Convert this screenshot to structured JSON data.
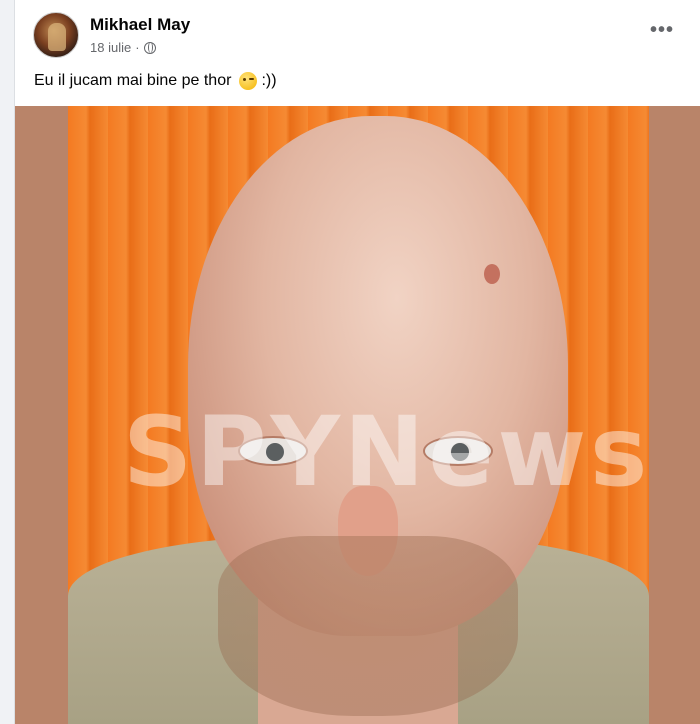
{
  "post": {
    "author": "Mikhael May",
    "date": "18 iulie",
    "separator": "·",
    "privacy_icon": "globe-icon",
    "more_label": "•••",
    "text": "Eu il jucam mai bine pe thor",
    "emoji_icon": "wink-emoji-icon",
    "text_suffix": ":))"
  },
  "photo": {
    "watermark": "SPYNews",
    "background_color": "#f47a22",
    "frame_color": "#b98469"
  }
}
